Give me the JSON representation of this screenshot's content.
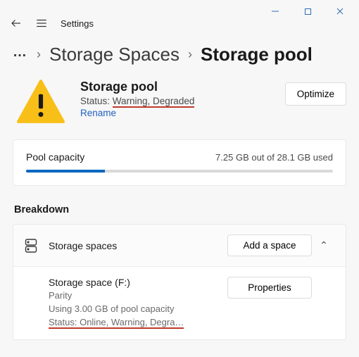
{
  "window": {
    "app_title": "Settings"
  },
  "breadcrumb": {
    "more": "…",
    "parent": "Storage Spaces",
    "current": "Storage pool"
  },
  "pool": {
    "name": "Storage pool",
    "status_prefix": "Status: ",
    "status_value": "Warning, Degraded ",
    "rename": "Rename",
    "optimize_btn": "Optimize"
  },
  "capacity": {
    "label": "Pool capacity",
    "usage_text": "7.25 GB out of 28.1 GB used",
    "used_gb": 7.25,
    "total_gb": 28.1
  },
  "breakdown": {
    "title": "Breakdown",
    "spaces_label": "Storage spaces",
    "add_space_btn": "Add a space",
    "space": {
      "title": "Storage space (F:)",
      "type": "Parity",
      "usage": "Using 3.00 GB of pool capacity",
      "status": "Status: Online, Warning, Degra…",
      "properties_btn": "Properties"
    }
  }
}
